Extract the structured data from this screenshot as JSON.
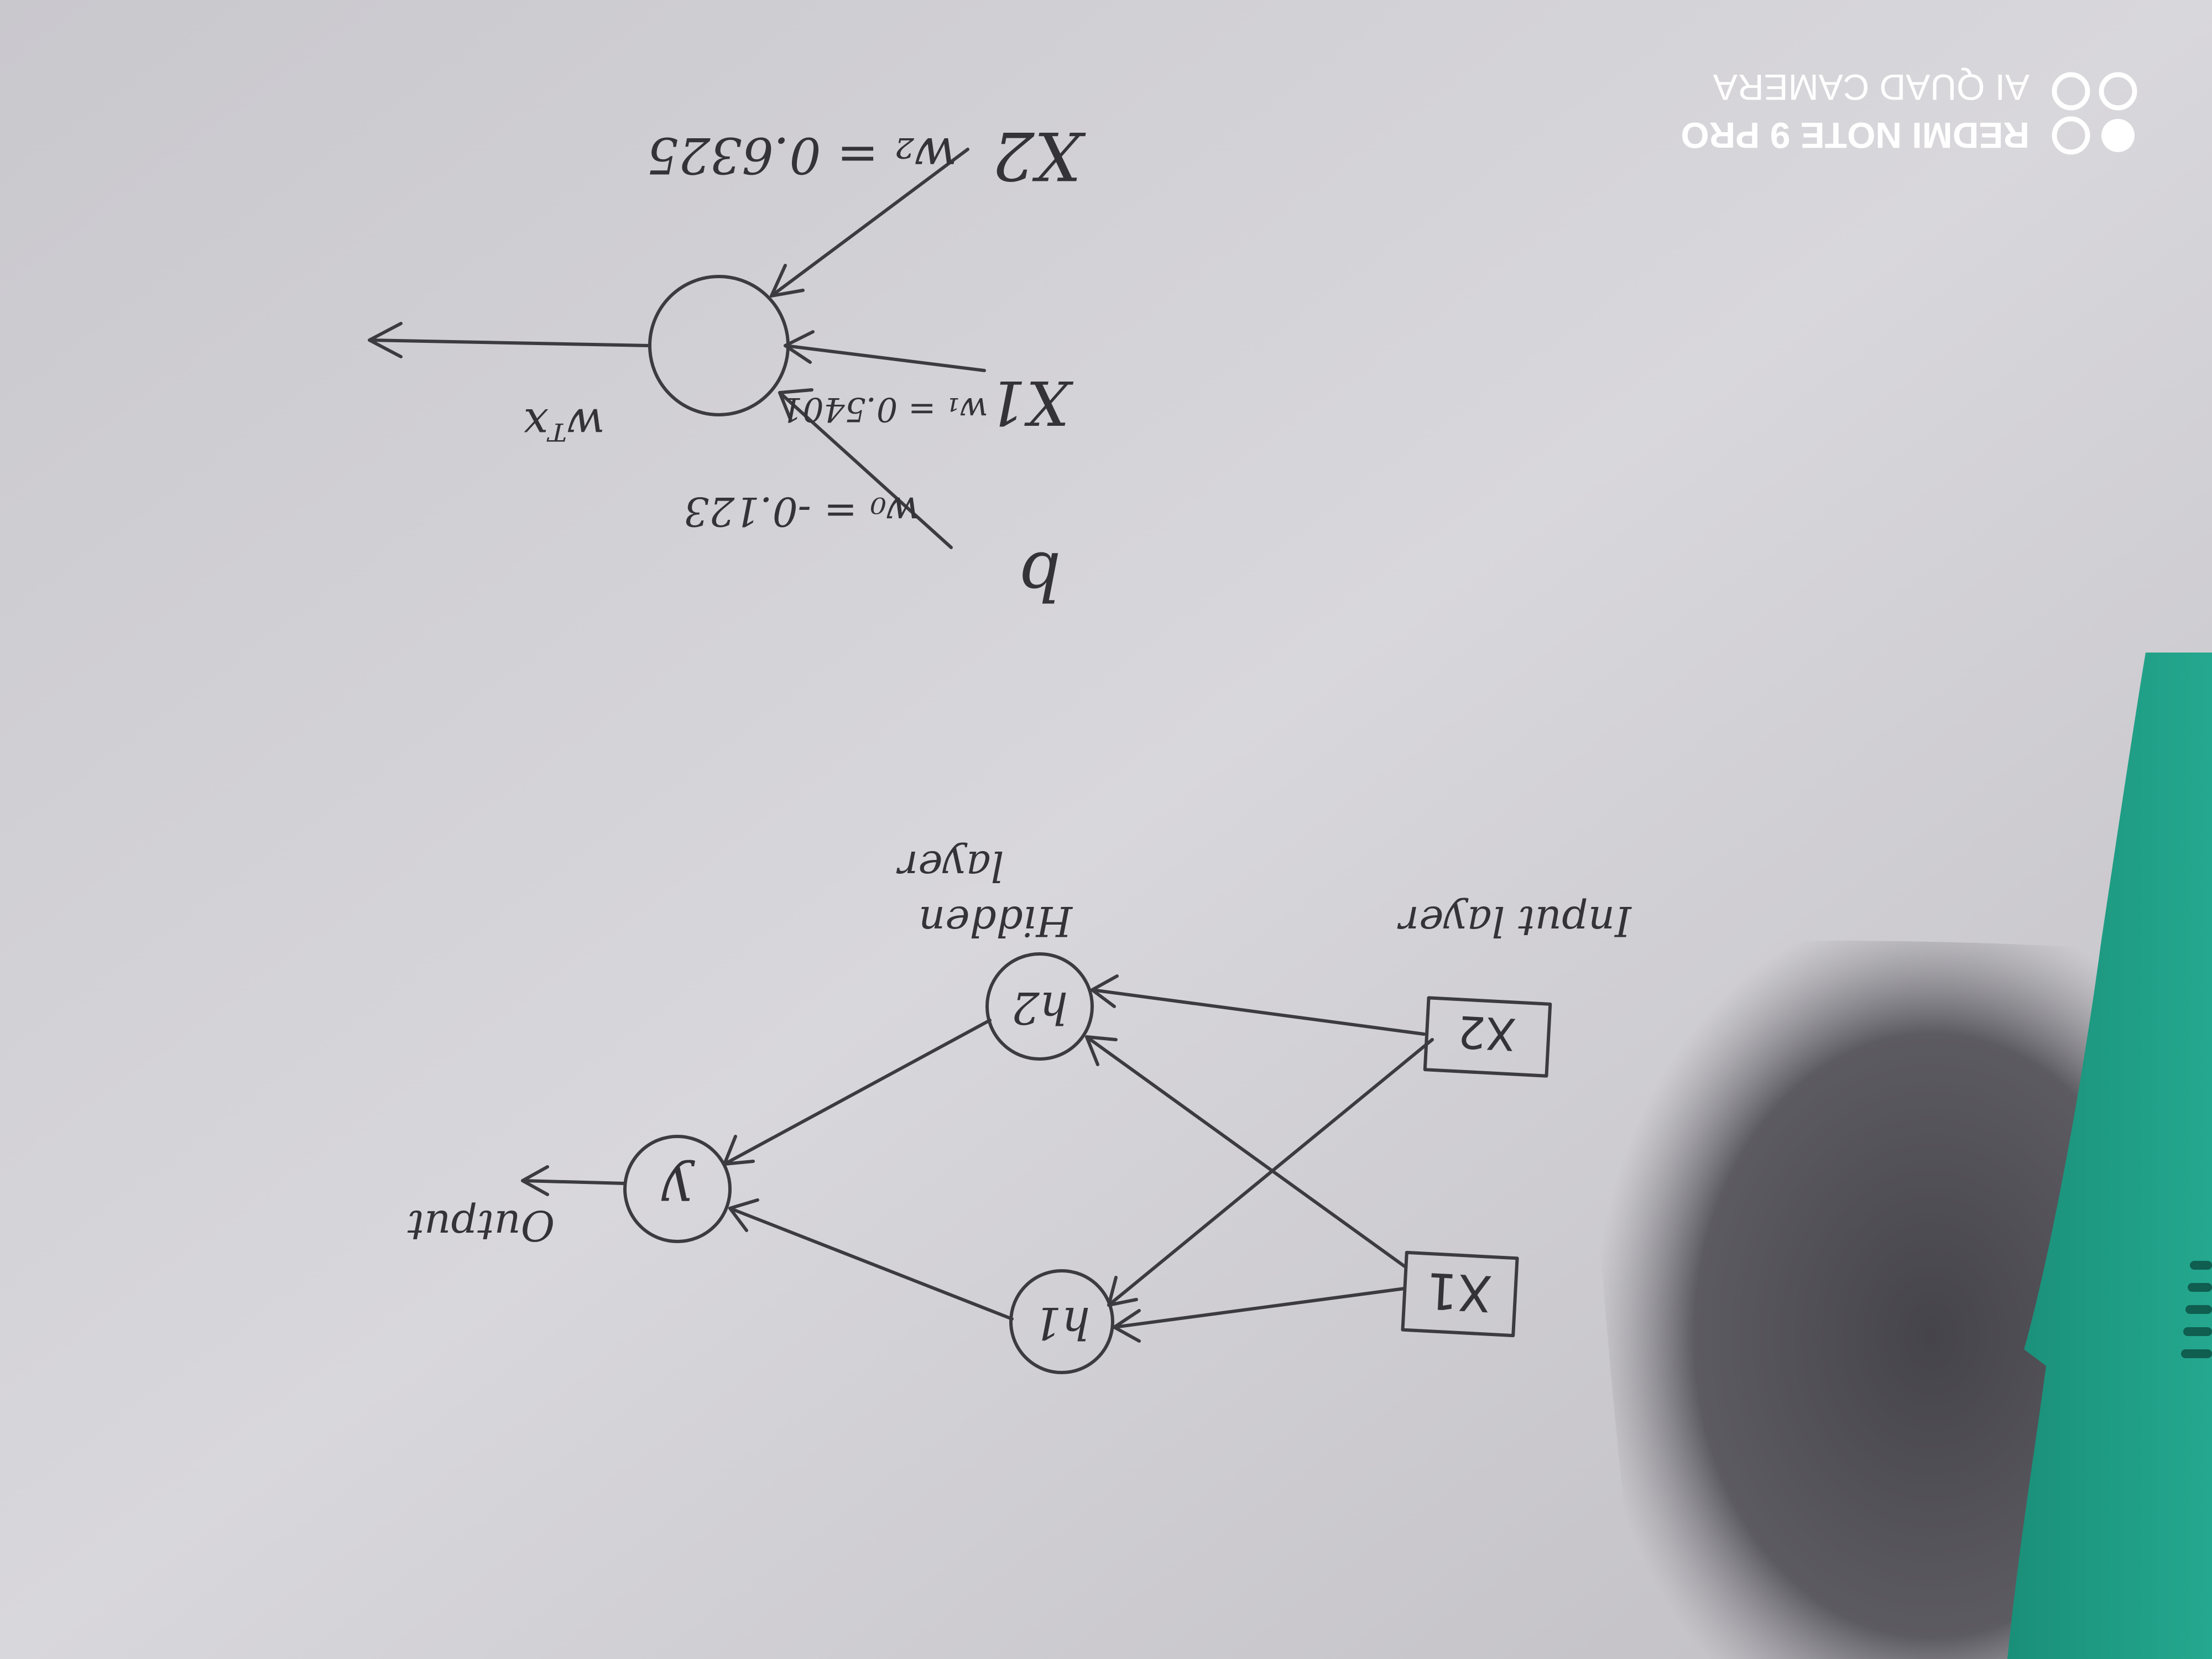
{
  "diagram": {
    "network": {
      "nodes": {
        "input_1": "X1",
        "input_2": "X2",
        "hidden_1": "h1",
        "hidden_2": "h2",
        "output": "y"
      },
      "labels": {
        "input_layer": "Input layer",
        "hidden_layer_line1": "Hidden",
        "hidden_layer_line2": "layer",
        "output": "Output"
      }
    },
    "neuron": {
      "inputs": {
        "bias": "b",
        "x1": "X1",
        "x2": "X2"
      },
      "weights": {
        "w0": "w₀ = -0.123",
        "w1": "w₁ = 0.5401",
        "w2": "w₂ = 0.6325"
      },
      "output_label": "wᵀx"
    }
  },
  "watermark": {
    "line1": "REDMI NOTE 9 PRO",
    "line2": "AI QUAD CAMERA"
  },
  "colors": {
    "paper": "#d9d8dc",
    "ink": "#3b3b40",
    "shadow": "#56555b",
    "object": "#1f9a83"
  }
}
